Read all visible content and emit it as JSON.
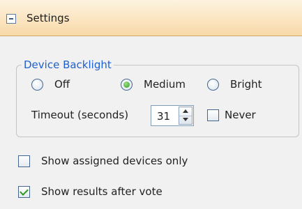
{
  "header": {
    "title": "Settings"
  },
  "backlight": {
    "legend": "Device Backlight",
    "options": [
      {
        "label": "Off",
        "checked": false
      },
      {
        "label": "Medium",
        "checked": true
      },
      {
        "label": "Bright",
        "checked": false
      }
    ],
    "timeout_label": "Timeout (seconds)",
    "timeout_value": "31",
    "never_label": "Never",
    "never_checked": false
  },
  "options": {
    "show_assigned_label": "Show assigned devices only",
    "show_assigned_checked": false,
    "show_results_label": "Show results after vote",
    "show_results_checked": true
  }
}
